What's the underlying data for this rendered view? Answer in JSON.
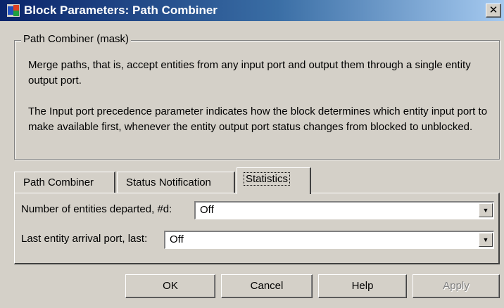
{
  "window": {
    "title": "Block Parameters: Path Combiner",
    "close_glyph": "✕",
    "icon": "simulink-block-icon"
  },
  "group": {
    "legend": "Path Combiner (mask)",
    "description_1": "Merge paths, that is, accept entities from any input port and output them through a single entity output port.",
    "description_2": "The Input port precedence parameter indicates how the block determines which entity input port to make available first, whenever the entity output port status changes from blocked to unblocked."
  },
  "tabs": [
    {
      "label": "Path Combiner",
      "active": false
    },
    {
      "label": "Status Notification",
      "active": false
    },
    {
      "label": "Statistics",
      "active": true
    }
  ],
  "fields": {
    "departed": {
      "label": "Number of entities departed, #d:",
      "value": "Off"
    },
    "last_port": {
      "label": "Last entity arrival port, last:",
      "value": "Off"
    }
  },
  "buttons": {
    "ok": "OK",
    "cancel": "Cancel",
    "help": "Help",
    "apply": "Apply",
    "apply_enabled": false
  },
  "colors": {
    "title_gradient_start": "#0a246a",
    "title_gradient_end": "#a6caf0",
    "dialog_face": "#d4d0c8"
  }
}
